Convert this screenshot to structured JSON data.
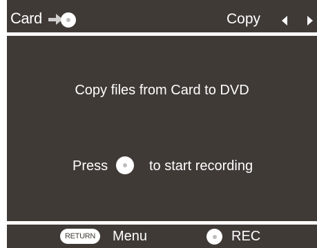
{
  "header": {
    "source_label": "Card",
    "mode_label": "Copy"
  },
  "body": {
    "line1": "Copy files from Card to DVD",
    "press_word": "Press",
    "press_after": "to start recording"
  },
  "footer": {
    "return_label": "RETURN",
    "menu_label": "Menu",
    "rec_label": "REC"
  },
  "colors": {
    "background": "#403a37",
    "foreground": "#ffffff"
  },
  "icons": [
    "arrow-right-icon",
    "disc-icon",
    "chevron-left-icon",
    "chevron-right-icon"
  ]
}
